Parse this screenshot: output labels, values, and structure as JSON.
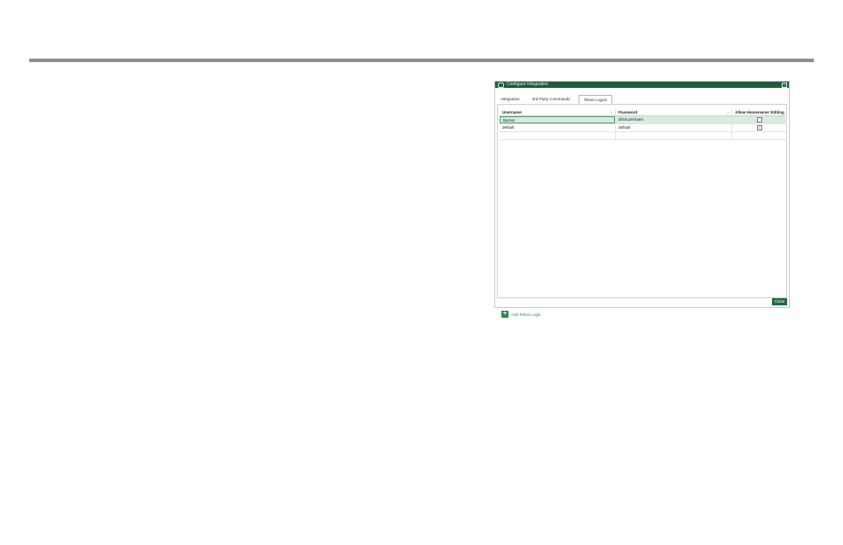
{
  "window": {
    "title": "Configure Integration",
    "close_glyph": "×"
  },
  "tabs": [
    {
      "label": "Integration"
    },
    {
      "label": "3rd Party Commands"
    },
    {
      "label": "Telnet Logins",
      "active": true
    }
  ],
  "grid": {
    "columns": [
      "Username",
      "Password",
      "Allow Homeowner Editing"
    ],
    "sort_arrow": "↕",
    "rows": [
      {
        "username": "Burner",
        "password": "dirtSuzen!ae4",
        "allow_editing": false,
        "selected": true
      },
      {
        "username": "default",
        "password": "default",
        "allow_editing": true,
        "selected": false
      }
    ]
  },
  "footer": {
    "add_label": "Add Telnet Login",
    "close_label": "Close"
  },
  "colors": {
    "accent": "#1f5c3d",
    "selected_row": "#d7ecdf",
    "add_green": "#2a8a4e"
  },
  "icons": {
    "app": "app-icon",
    "close": "close-icon",
    "add": "plus-icon",
    "check": "checkmark-icon"
  }
}
